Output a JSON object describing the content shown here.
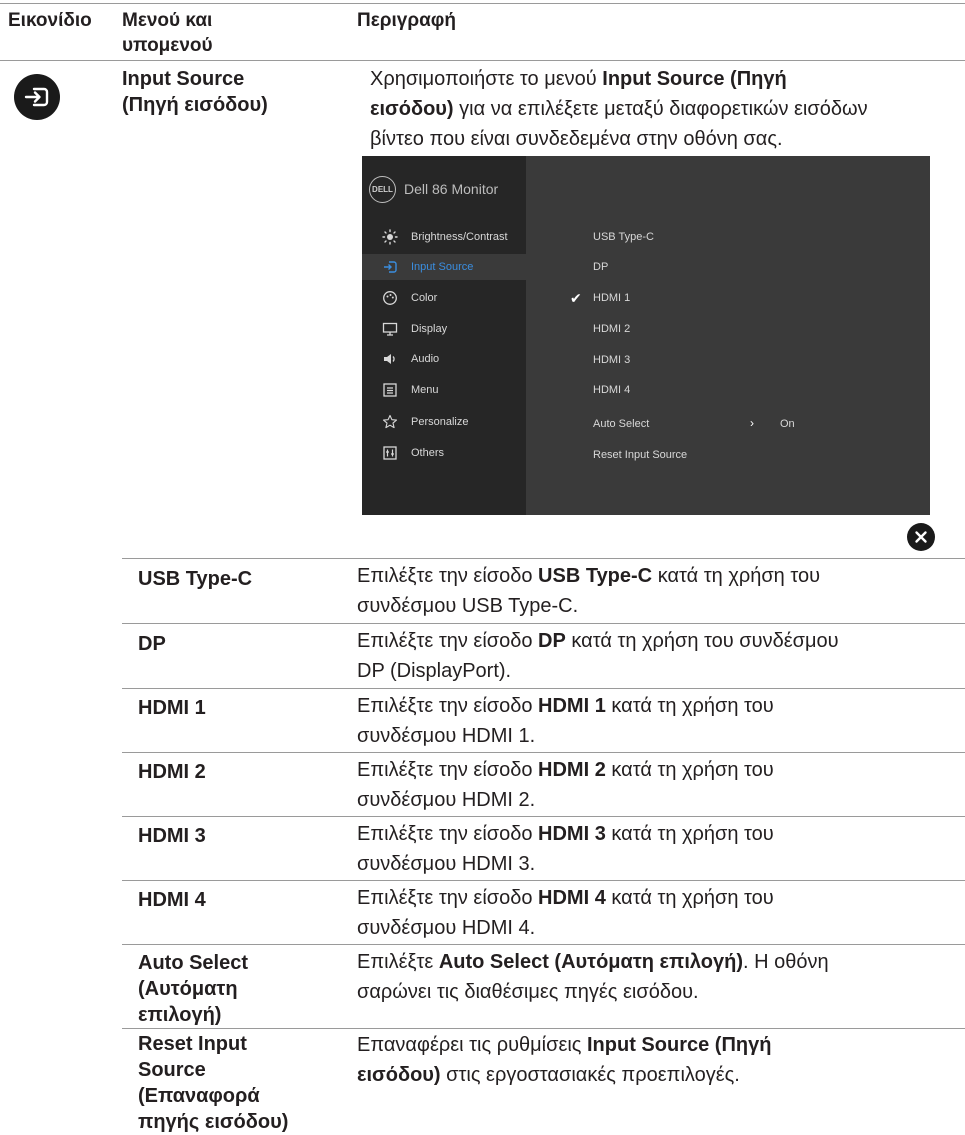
{
  "header": {
    "col_icon": "Εικονίδιο",
    "col_menu_l1": "Μενού και",
    "col_menu_l2": "υπομενού",
    "col_desc": "Περιγραφή"
  },
  "main": {
    "icon_name": "input-source-icon",
    "menu_l1": "Input Source",
    "menu_l2": "(Πηγή εισόδου)",
    "desc_l1_pre": "Χρησιμοποιήστε το μενού ",
    "desc_l1_bold": "Input Source (Πηγή",
    "desc_l2_bold": "εισόδου)",
    "desc_l2_post": " για να επιλέξετε μεταξύ διαφορετικών εισόδων",
    "desc_l3": "βίντεο που είναι συνδεδεμένα στην οθόνη σας."
  },
  "osd": {
    "logo_text": "DELL",
    "title": "Dell 86 Monitor",
    "menu": [
      {
        "label": "Brightness/Contrast",
        "icon": "brightness-icon"
      },
      {
        "label": "Input Source",
        "icon": "input-source-icon",
        "selected": true
      },
      {
        "label": "Color",
        "icon": "color-palette-icon"
      },
      {
        "label": "Display",
        "icon": "display-monitor-icon"
      },
      {
        "label": "Audio",
        "icon": "speaker-icon"
      },
      {
        "label": "Menu",
        "icon": "menu-icon"
      },
      {
        "label": "Personalize",
        "icon": "star-icon"
      },
      {
        "label": "Others",
        "icon": "others-icon"
      }
    ],
    "options": [
      "USB Type-C",
      "DP",
      "HDMI 1",
      "HDMI 2",
      "HDMI 3",
      "HDMI 4",
      "Auto Select",
      "Reset Input Source"
    ],
    "checked_option": "HDMI 1",
    "auto_select_value": "On",
    "accent_color": "#3a8ee0"
  },
  "close_icon": "close-icon",
  "rows": [
    {
      "name_l1": "USB Type-C",
      "d1_pre": "Επιλέξτε την είσοδο ",
      "d1_bold": "USB Type-C",
      "d1_post": " κατά τη χρήση του",
      "d2": "συνδέσμου USB Type-C."
    },
    {
      "name_l1": "DP",
      "d1_pre": "Επιλέξτε την είσοδο ",
      "d1_bold": "DP",
      "d1_post": " κατά τη χρήση του συνδέσμου",
      "d2": "DP (DisplayPort)."
    },
    {
      "name_l1": "HDMI 1",
      "d1_pre": "Επιλέξτε την είσοδο ",
      "d1_bold": "HDMI 1",
      "d1_post": " κατά τη χρήση του",
      "d2": "συνδέσμου HDMI 1."
    },
    {
      "name_l1": "HDMI 2",
      "d1_pre": "Επιλέξτε την είσοδο ",
      "d1_bold": "HDMI 2",
      "d1_post": " κατά τη χρήση του",
      "d2": "συνδέσμου HDMI 2."
    },
    {
      "name_l1": "HDMI 3",
      "d1_pre": "Επιλέξτε την είσοδο ",
      "d1_bold": "HDMI 3",
      "d1_post": " κατά τη χρήση του",
      "d2": "συνδέσμου HDMI 3."
    },
    {
      "name_l1": "HDMI 4",
      "d1_pre": "Επιλέξτε την είσοδο ",
      "d1_bold": "HDMI 4",
      "d1_post": " κατά τη χρήση του",
      "d2": "συνδέσμου HDMI 4."
    }
  ],
  "auto_select": {
    "name_l1": "Auto Select",
    "name_l2": "(Αυτόματη",
    "name_l3": "επιλογή)",
    "d1_pre": "Επιλέξτε ",
    "d1_bold": "Auto Select (Αυτόματη επιλογή)",
    "d1_post": ". Η οθόνη",
    "d2": "σαρώνει τις διαθέσιμες πηγές εισόδου."
  },
  "reset": {
    "name_l1": "Reset Input",
    "name_l2": "Source",
    "name_l3": "(Επαναφορά",
    "name_l4": "πηγής εισόδου)",
    "d1_pre": "Επαναφέρει τις ρυθμίσεις ",
    "d1_bold": "Input Source (Πηγή",
    "d2_bold": "εισόδου)",
    "d2_post": " στις εργοστασιακές προεπιλογές."
  }
}
